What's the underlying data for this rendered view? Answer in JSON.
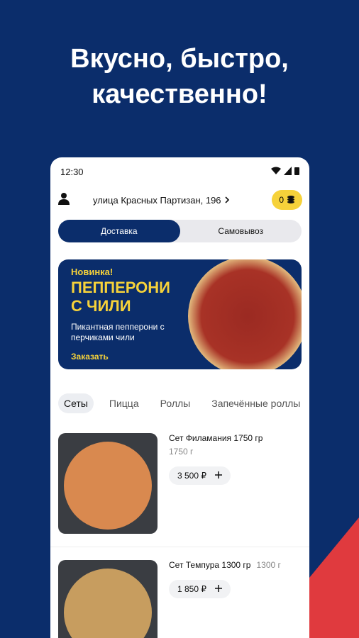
{
  "headline": {
    "line1": "Вкусно, быстро,",
    "line2": "качественно!"
  },
  "status": {
    "time": "12:30"
  },
  "header": {
    "address": "улица Красных Партизан, 196",
    "coins": "0"
  },
  "delivery_mode": {
    "options": [
      "Доставка",
      "Самовывоз"
    ]
  },
  "banner": {
    "label": "Новинка!",
    "title": "ПЕППЕРОНИ С ЧИЛИ",
    "desc": "Пикантная пепперони с перчиками чили",
    "cta": "Заказать"
  },
  "categories": [
    "Сеты",
    "Пицца",
    "Роллы",
    "Запечённые роллы"
  ],
  "products": [
    {
      "name": "Сет Филамания 1750 гр",
      "weight": "1750 г",
      "price": "3 500 ₽"
    },
    {
      "name": "Сет Темпура 1300 гр",
      "weight": "1300 г",
      "price": "1 850 ₽"
    }
  ],
  "colors": {
    "brand_blue": "#0b2d6b",
    "accent_yellow": "#f6d23a",
    "accent_red": "#e03a3e"
  }
}
